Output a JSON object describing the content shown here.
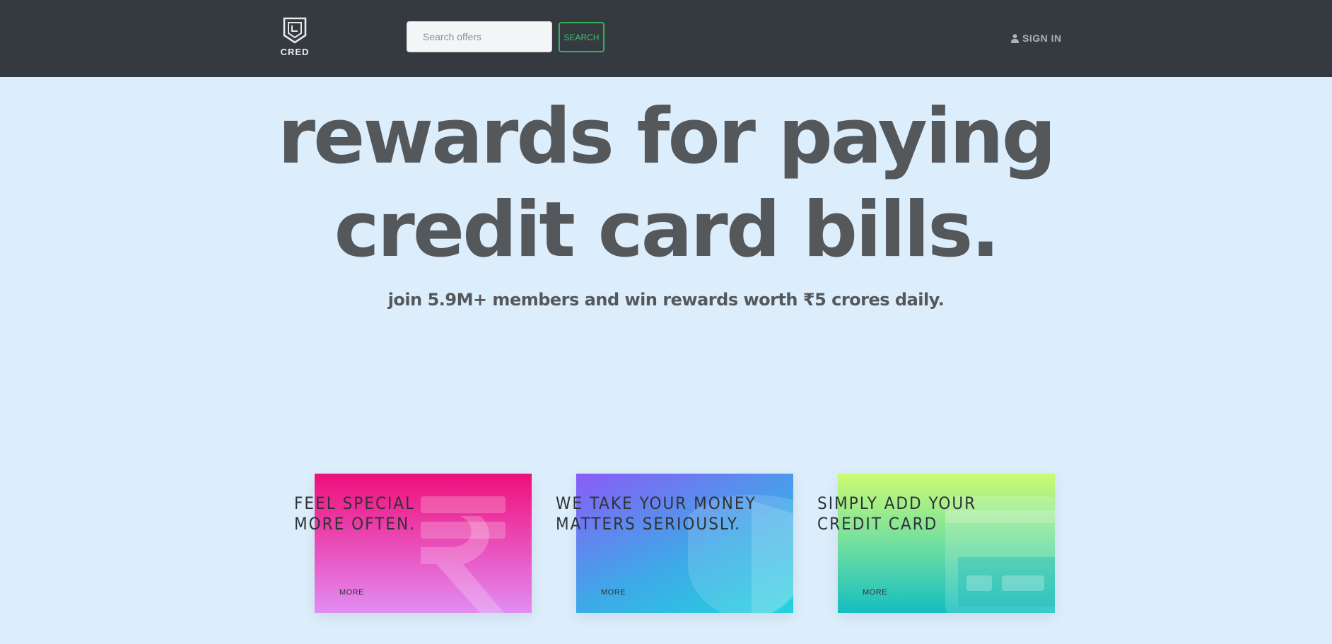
{
  "header": {
    "logo_text": "CRED",
    "search": {
      "placeholder": "Search offers",
      "value": "",
      "button_label": "SEARCH"
    },
    "sign_in_label": "SIGN IN"
  },
  "hero": {
    "title_line1": "rewards for paying",
    "title_line2": "credit card bills.",
    "subtitle": "join 5.9M+ members and win rewards worth ₹5 crores daily."
  },
  "cards": [
    {
      "title_line1": "FEEL SPECIAL",
      "title_line2": "MORE OFTEN.",
      "more_label": "MORE",
      "icon": "rupee-icon"
    },
    {
      "title_line1": "WE TAKE YOUR MONEY",
      "title_line2": "MATTERS SERIOUSLY.",
      "more_label": "MORE",
      "icon": "shield-icon"
    },
    {
      "title_line1": "SIMPLY ADD YOUR",
      "title_line2": "CREDIT CARD",
      "more_label": "MORE",
      "icon": "credit-card-icon"
    }
  ],
  "colors": {
    "navbar": "#343a40",
    "page_background": "#dcedfb",
    "search_accent": "#34b25a",
    "headline": "#55585b"
  }
}
